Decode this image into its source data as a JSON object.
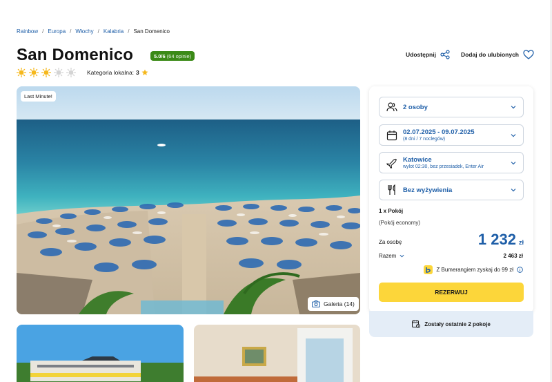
{
  "breadcrumb": [
    "Rainbow",
    "Europa",
    "Włochy",
    "Kalabria",
    "San Domenico"
  ],
  "breadcrumb_sep": "/",
  "hotel": {
    "name": "San Domenico",
    "rating_score": "5.0/6",
    "rating_count": "(64 opinie)",
    "sun_rating": 3,
    "sun_max": 5,
    "local_category_label": "Kategoria lokalna:",
    "local_category_value": "3"
  },
  "actions": {
    "share": "Udostępnij",
    "favorite": "Dodaj do ulubionych"
  },
  "hero": {
    "badge": "Last Minute!",
    "gallery": "Galeria (14)"
  },
  "booking": {
    "persons": "2 osoby",
    "dates": "02.07.2025 - 09.07.2025",
    "dates_sub": "(8 dni / 7 noclegów)",
    "departure": "Katowice",
    "departure_sub": "wylot 02:30, bez przesiadek, Enter Air",
    "board": "Bez wyżywienia",
    "room_count": "1 x Pokój",
    "room_type": "(Pokój economy)",
    "per_person_label": "Za osobę",
    "per_person_price": "1 232",
    "currency": "zł",
    "total_label": "Razem",
    "total_value": "2 463 zł",
    "bumerang_text": "Z Bumerangiem zyskaj do 99 zł",
    "reserve_label": "REZERWUJ",
    "rooms_left": "Zostały ostatnie 2 pokoje"
  },
  "colors": {
    "accent": "#1f5fa8",
    "rating_green": "#3b8a17",
    "cta": "#fcd63a",
    "sun": "#f5b81d"
  }
}
